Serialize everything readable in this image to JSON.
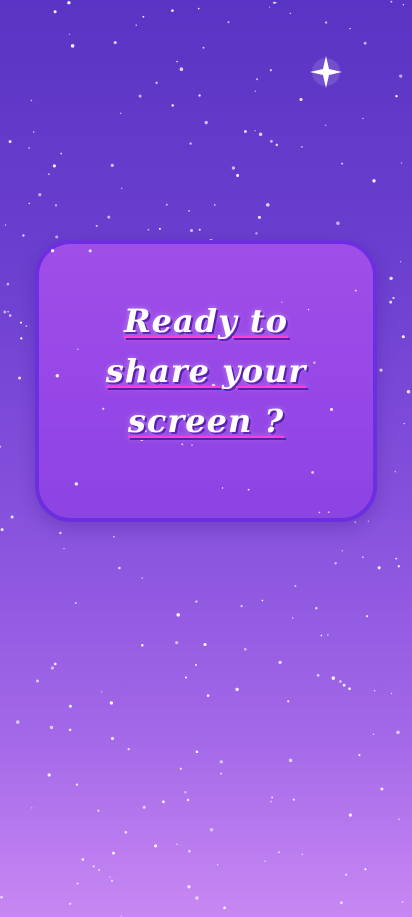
{
  "screen": {
    "background_colors": [
      "#5a34c4",
      "#8550dc",
      "#c888f3"
    ],
    "decoration_icon": "four-point-sparkle-icon"
  },
  "card": {
    "title": "Ready to share your screen ?",
    "background_color": "#9546e6",
    "border_color": "#6c2fe0",
    "underline_color": "#ff3fd8"
  }
}
